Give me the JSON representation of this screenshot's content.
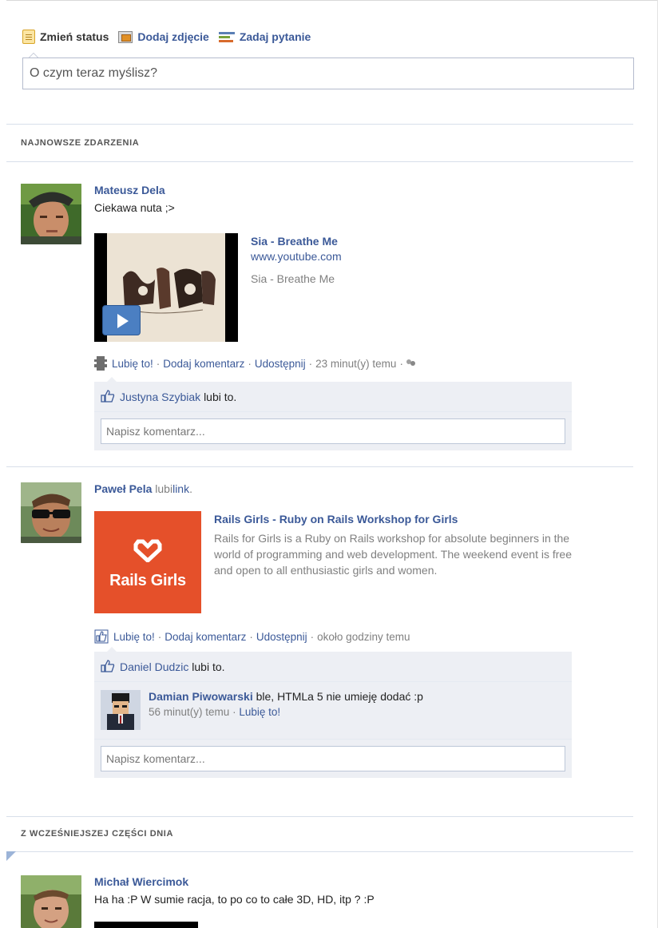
{
  "composer": {
    "tabs": [
      {
        "label": "Zmień status",
        "icon": "status-icon"
      },
      {
        "label": "Dodaj zdjęcie",
        "icon": "photo-icon"
      },
      {
        "label": "Zadaj pytanie",
        "icon": "question-icon"
      }
    ],
    "placeholder": "O czym teraz myślisz?"
  },
  "sections": {
    "recent": "NAJNOWSZE ZDARZENIA",
    "earlier": "Z WCZEŚNIEJSZEJ CZĘŚCI DNIA"
  },
  "stories": [
    {
      "actor": "Mateusz Dela",
      "message": "Ciekawa nuta ;>",
      "attachment": {
        "title": "Sia - Breathe Me",
        "caption": "www.youtube.com",
        "description": "Sia - Breathe Me"
      },
      "actions": {
        "like": "Lubię to!",
        "comment": "Dodaj komentarz",
        "share": "Udostępnij",
        "time": "23 minut(y) temu"
      },
      "likes": {
        "name": "Justyna Szybiak",
        "text": "lubi to."
      },
      "comment_placeholder": "Napisz komentarz..."
    },
    {
      "actor": "Paweł Pela",
      "verb": "lubi",
      "object": "link",
      "attachment": {
        "title": "Rails Girls - Ruby on Rails Workshop for Girls",
        "thumb_label": "Rails Girls",
        "description": "Rails for Girls is a Ruby on Rails workshop for absolute beginners in the world of programming and web development. The weekend event is free and open to all enthusiastic girls and women."
      },
      "actions": {
        "like": "Lubię to!",
        "comment": "Dodaj komentarz",
        "share": "Udostępnij",
        "time": "około godziny temu"
      },
      "likes": {
        "name": "Daniel Dudzic",
        "text": "lubi to."
      },
      "comment": {
        "author": "Damian Piwowarski",
        "text": "ble, HTMLa 5 nie umieję dodać :p",
        "time": "56 minut(y) temu",
        "like": "Lubię to!"
      },
      "comment_placeholder": "Napisz komentarz..."
    },
    {
      "actor": "Michał Wiercimok",
      "message": "Ha ha :P W sumie racja, to po co to całe 3D, HD, itp ? :P"
    }
  ],
  "colors": {
    "link": "#3b5998",
    "ufi_bg": "#edeff4",
    "rails_red": "#e5502a"
  }
}
